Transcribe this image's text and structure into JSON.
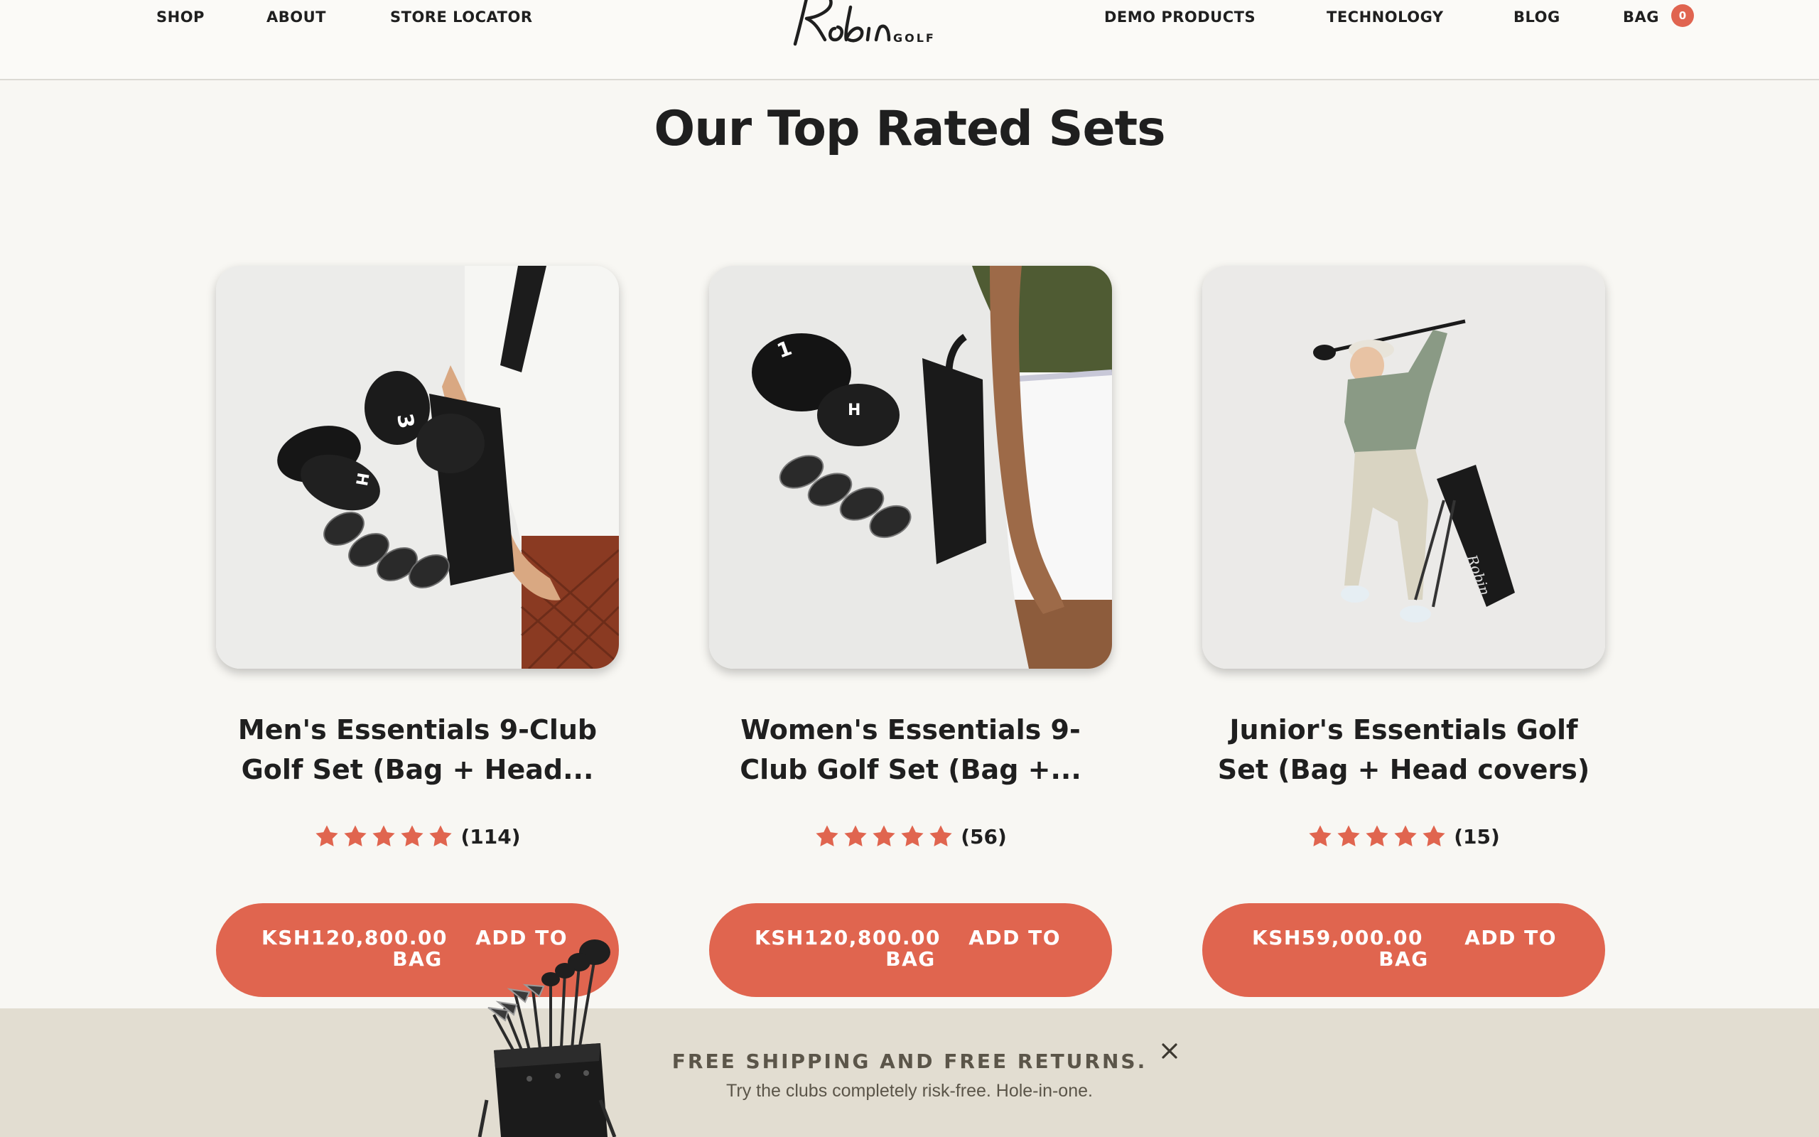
{
  "nav": {
    "left": [
      "SHOP",
      "ABOUT",
      "STORE LOCATOR"
    ],
    "right": [
      "DEMO PRODUCTS",
      "TECHNOLOGY",
      "BLOG",
      "BAG"
    ],
    "bag_count": "0"
  },
  "logo": {
    "script": "Robin",
    "sub": "GOLF"
  },
  "section": {
    "title": "Our Top Rated Sets"
  },
  "products": [
    {
      "title": "Men's Essentials 9-Club Golf Set (Bag + Head...",
      "rating": 5,
      "review_count": "(114)",
      "price": "KSH120,800.00",
      "add_label": "ADD TO",
      "bag_label": "BAG"
    },
    {
      "title": "Women's Essentials 9-Club Golf Set (Bag +...",
      "rating": 5,
      "review_count": "(56)",
      "price": "KSH120,800.00",
      "add_label": "ADD TO",
      "bag_label": "BAG"
    },
    {
      "title": "Junior's Essentials Golf Set (Bag + Head covers)",
      "rating": 5,
      "review_count": "(15)",
      "price": "KSH59,000.00",
      "add_label": "ADD TO",
      "bag_label": "BAG"
    }
  ],
  "promo": {
    "headline": "FREE SHIPPING AND FREE RETURNS.",
    "subtext": "Try the clubs completely risk-free. Hole-in-one.",
    "close_icon": "close-icon"
  },
  "colors": {
    "accent": "#e0654f",
    "background": "#f8f7f3",
    "promo_background": "#e2ddd1",
    "text": "#1f1f1f",
    "star": "#e0654f"
  }
}
